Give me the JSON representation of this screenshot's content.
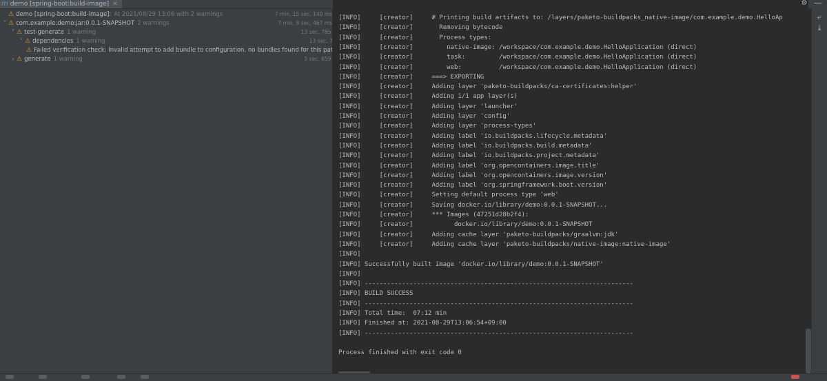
{
  "tab": {
    "icon": "m",
    "label": "demo [spring-boot:build-image]"
  },
  "tree": [
    {
      "depth": 0,
      "chevron": "",
      "label": "demo [spring-boot:build-image]:",
      "sub": "At 2021/08/29 13:06 with 2 warnings",
      "duration": "7 min, 15 sec, 140 ms"
    },
    {
      "depth": 0,
      "chevron": "˅",
      "label": "com.example:demo:jar:0.0.1-SNAPSHOT",
      "sub": "2 warnings",
      "duration": "7 min, 9 sec, 467 ms"
    },
    {
      "depth": 1,
      "chevron": "˅",
      "label": "test-generate",
      "sub": "1 warning",
      "duration": "13 sec, 785 ms"
    },
    {
      "depth": 2,
      "chevron": "˅",
      "label": "dependencies",
      "sub": "1 warning",
      "duration": "13 sec, 775 ms"
    },
    {
      "depth": 3,
      "chevron": "",
      "label": "Failed verification check: Invalid attempt to add bundle to configuration, no bundles found for this pattern: org.aspectj.wea",
      "sub": "",
      "duration": ""
    },
    {
      "depth": 1,
      "chevron": "›",
      "label": "generate",
      "sub": "1 warning",
      "duration": "5 sec, 659 ms"
    }
  ],
  "console": [
    "[INFO]     [creator]     # Printing build artifacts to: /layers/paketo-buildpacks_native-image/com.example.demo.HelloAp",
    "[INFO]     [creator]       Removing bytecode",
    "[INFO]     [creator]       Process types:",
    "[INFO]     [creator]         native-image: /workspace/com.example.demo.HelloApplication (direct)",
    "[INFO]     [creator]         task:         /workspace/com.example.demo.HelloApplication (direct)",
    "[INFO]     [creator]         web:          /workspace/com.example.demo.HelloApplication (direct)",
    "[INFO]     [creator]     ===> EXPORTING",
    "[INFO]     [creator]     Adding layer 'paketo-buildpacks/ca-certificates:helper'",
    "[INFO]     [creator]     Adding 1/1 app layer(s)",
    "[INFO]     [creator]     Adding layer 'launcher'",
    "[INFO]     [creator]     Adding layer 'config'",
    "[INFO]     [creator]     Adding layer 'process-types'",
    "[INFO]     [creator]     Adding label 'io.buildpacks.lifecycle.metadata'",
    "[INFO]     [creator]     Adding label 'io.buildpacks.build.metadata'",
    "[INFO]     [creator]     Adding label 'io.buildpacks.project.metadata'",
    "[INFO]     [creator]     Adding label 'org.opencontainers.image.title'",
    "[INFO]     [creator]     Adding label 'org.opencontainers.image.version'",
    "[INFO]     [creator]     Adding label 'org.springframework.boot.version'",
    "[INFO]     [creator]     Setting default process type 'web'",
    "[INFO]     [creator]     Saving docker.io/library/demo:0.0.1-SNAPSHOT...",
    "[INFO]     [creator]     *** Images (47251d28b2f4):",
    "[INFO]     [creator]           docker.io/library/demo:0.0.1-SNAPSHOT",
    "[INFO]     [creator]     Adding cache layer 'paketo-buildpacks/graalvm:jdk'",
    "[INFO]     [creator]     Adding cache layer 'paketo-buildpacks/native-image:native-image'",
    "[INFO]",
    "[INFO] Successfully built image 'docker.io/library/demo:0.0.1-SNAPSHOT'",
    "[INFO]",
    "[INFO] ------------------------------------------------------------------------",
    "[INFO] BUILD SUCCESS",
    "[INFO] ------------------------------------------------------------------------",
    "[INFO] Total time:  07:12 min",
    "[INFO] Finished at: 2021-08-29T13:06:54+09:00",
    "[INFO] ------------------------------------------------------------------------",
    "",
    "Process finished with exit code 0"
  ],
  "icons": {
    "settings": "gear-icon",
    "minimize": "minimize-icon",
    "soft_wrap": "soft-wrap-icon",
    "scroll_end": "scroll-to-end-icon",
    "warning": "warning-icon"
  },
  "colors": {
    "warning": "#e2a42b",
    "background": "#2b2b2b",
    "panel": "#3c3f41"
  }
}
